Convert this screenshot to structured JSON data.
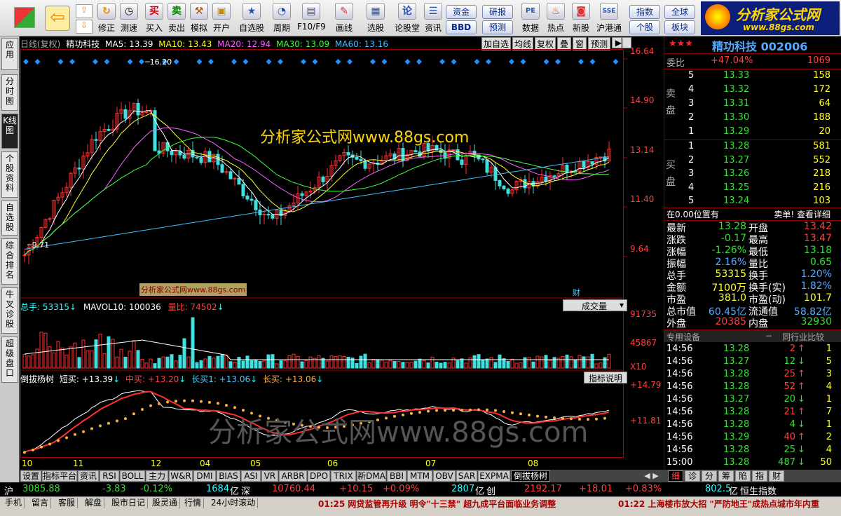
{
  "toolbar": {
    "buttons": [
      "买入",
      "卖出",
      "模拟",
      "开户",
      "自选股",
      "周期",
      "F10/F9",
      "画线",
      "选股",
      "论股堂",
      "资讯",
      "数据",
      "热点",
      "新股",
      "沪港通"
    ],
    "nav": [
      "修正",
      "测速"
    ],
    "small": [
      "资金",
      "BBD",
      "研报",
      "预测",
      "指数",
      "个股",
      "全球",
      "板块"
    ],
    "logo": "分析家公式网",
    "logo_url": "www.88gs.com"
  },
  "left_tabs": [
    "应用",
    "分时图",
    "K线图",
    "个股资料",
    "自选股",
    "综合排名",
    "牛叉诊股",
    "超级盘口"
  ],
  "chart": {
    "header": {
      "title": "日线(复权)",
      "stock": "精功科技",
      "ma5": "MA5: 13.39",
      "ma10": "MA10: 13.43",
      "ma20": "MA20: 12.94",
      "ma30": "MA30: 13.09",
      "ma60": "MA60: 13.16"
    },
    "top_buttons": [
      "加自选",
      "均线",
      "复权",
      "叠",
      "窗",
      "预测"
    ],
    "price_axis": [
      "16.64",
      "14.90",
      "13.14",
      "11.40",
      "9.64"
    ],
    "high_label": "16.20",
    "low_label": "9.71",
    "watermark_top": "分析家公式网www.88gs.com",
    "watermark_small": "分析家公式网www.88gs.com",
    "watermark_bottom": "分析家公式网www.88gs.com",
    "cai_label": "财",
    "vol_header": {
      "total": "总手: 53315",
      "mavol": "MAVOL10: 100036",
      "ratio": "量比: 74502"
    },
    "vol_dropdown": "成交量",
    "vol_axis": [
      "91735",
      "45867",
      "X10"
    ],
    "ind_header": {
      "name": "倒拔杨树",
      "short": "短买: +13.39",
      "mid": "中买: +13.20",
      "long1": "长买1: +13.06",
      "long": "长买: +13.06"
    },
    "ind_button": "指标说明",
    "ind_axis": [
      "+14.79",
      "+11.81"
    ],
    "months": [
      "10",
      "11",
      "12",
      "04",
      "05",
      "06",
      "07",
      "08"
    ]
  },
  "quote": {
    "name": "精功科技 002006",
    "weibi_label": "委比",
    "weibi": "+47.04%",
    "weicha": "1069",
    "sell_label": "卖盘",
    "buy_label": "买盘",
    "asks": [
      {
        "n": "5",
        "p": "13.33",
        "v": "158"
      },
      {
        "n": "4",
        "p": "13.32",
        "v": "172"
      },
      {
        "n": "3",
        "p": "13.31",
        "v": "64"
      },
      {
        "n": "2",
        "p": "13.30",
        "v": "188"
      },
      {
        "n": "1",
        "p": "13.29",
        "v": "20"
      }
    ],
    "bids": [
      {
        "n": "1",
        "p": "13.28",
        "v": "581"
      },
      {
        "n": "2",
        "p": "13.27",
        "v": "552"
      },
      {
        "n": "3",
        "p": "13.26",
        "v": "218"
      },
      {
        "n": "4",
        "p": "13.25",
        "v": "216"
      },
      {
        "n": "5",
        "p": "13.24",
        "v": "103"
      }
    ],
    "pos_note": "在0.00位置有",
    "pos_link": "卖单! 查看详细",
    "stats": [
      [
        "最新",
        "13.28",
        "开盘",
        "13.42"
      ],
      [
        "涨跌",
        "-0.17",
        "最高",
        "13.47"
      ],
      [
        "涨幅",
        "-1.26%",
        "最低",
        "13.18"
      ],
      [
        "振幅",
        "2.16%",
        "量比",
        "0.65"
      ],
      [
        "总手",
        "53315",
        "换手",
        "1.20%"
      ],
      [
        "金额",
        "7100万",
        "换手(实)",
        "1.82%"
      ],
      [
        "市盈",
        "381.0",
        "市盈(动)",
        "101.7"
      ],
      [
        "总市值",
        "60.45亿",
        "流通值",
        "58.82亿"
      ],
      [
        "外盘",
        "20385",
        "内盘",
        "32930"
      ]
    ],
    "tick_header": "专用设备",
    "tick_compare": "同行业比较",
    "ticks": [
      [
        "14:56",
        "13.28",
        "2",
        "up",
        "1"
      ],
      [
        "14:56",
        "13.27",
        "12",
        "dn",
        "5"
      ],
      [
        "14:56",
        "13.28",
        "25",
        "up",
        "3"
      ],
      [
        "14:56",
        "13.28",
        "52",
        "up",
        "4"
      ],
      [
        "14:56",
        "13.27",
        "20",
        "dn",
        "1"
      ],
      [
        "14:56",
        "13.28",
        "21",
        "up",
        "7"
      ],
      [
        "14:56",
        "13.28",
        "4",
        "dn",
        "1"
      ],
      [
        "14:56",
        "13.29",
        "40",
        "up",
        "2"
      ],
      [
        "14:56",
        "13.28",
        "25",
        "dn",
        "4"
      ],
      [
        "15:00",
        "13.28",
        "487",
        "dn",
        "50"
      ]
    ],
    "bottom_tabs": [
      "细",
      "诊",
      "分",
      "筹",
      "陷",
      "指",
      "财"
    ]
  },
  "bottom_tabs": [
    "设置",
    "指标平台",
    "资讯",
    "RSI",
    "BOLL",
    "主力",
    "W&R",
    "DMI",
    "BIAS",
    "ASI",
    "VR",
    "ARBR",
    "DPO",
    "TRIX",
    "新DMA",
    "BBI",
    "MTM",
    "OBV",
    "SAR",
    "EXPMA",
    "倒拔杨树"
  ],
  "status": {
    "sh_label": "沪",
    "sh": "3085.88",
    "sh_chg": "-3.83",
    "sh_pct": "-0.12%",
    "sh_amt": "1684",
    "yi": "亿",
    "sz_label": "深",
    "sz": "10760.44",
    "sz_chg": "+10.15",
    "sz_pct": "+0.09%",
    "sz_amt": "2807",
    "cy_label": "创",
    "cy": "2192.17",
    "cy_chg": "+18.01",
    "cy_pct": "+0.83%",
    "hk_amt": "802.5",
    "hk_label": "恒生指数"
  },
  "news_buttons": [
    "手机",
    "留言",
    "客服",
    "解盘",
    "股市日记",
    "股灵通",
    "行情",
    "24小时滚动"
  ],
  "news1": "01:25 网贷监管再升级 明令\"十三禁\" 超九成平台面临业务调整",
  "news2": "01:22 上海楼市放大招 \"严防地王\"成热点城市年内重"
}
